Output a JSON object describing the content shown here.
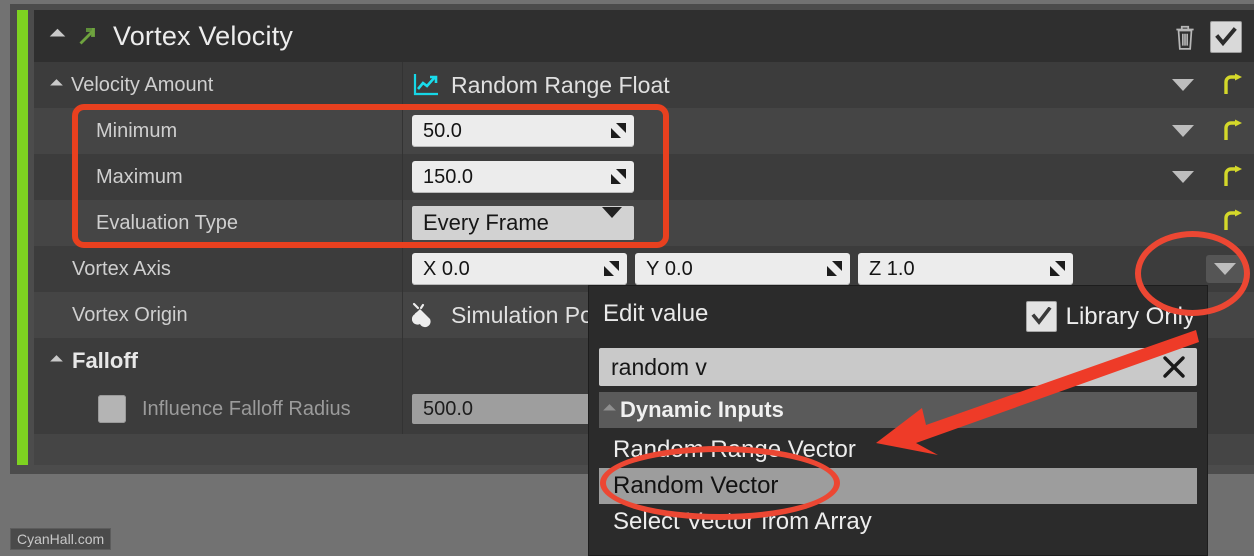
{
  "panel": {
    "category": {
      "title": "Vortex Velocity",
      "expand_icon": "collapse-triangle-icon",
      "module_icon": "green-arrow-icon",
      "delete_icon": "trash-icon",
      "enabled_checkbox": "checked"
    },
    "rows": [
      {
        "label": "Velocity Amount",
        "value_type_icon": "line-chart-icon",
        "value_text": "Random Range Float",
        "has_dropdown": true,
        "has_reset": true
      },
      {
        "label": "Minimum",
        "value_text": "50.0",
        "field_kind": "number",
        "has_dropdown": true,
        "has_reset": true
      },
      {
        "label": "Maximum",
        "value_text": "150.0",
        "field_kind": "number",
        "has_dropdown": true,
        "has_reset": true
      },
      {
        "label": "Evaluation Type",
        "value_text": "Every Frame",
        "field_kind": "combo",
        "has_dropdown": false,
        "has_reset": true
      },
      {
        "label": "Vortex Axis",
        "field_kind": "vector",
        "components": [
          {
            "axis": "X",
            "value": "0.0"
          },
          {
            "axis": "Y",
            "value": "0.0"
          },
          {
            "axis": "Z",
            "value": "1.0"
          }
        ],
        "has_dropdown": true,
        "has_reset": false
      },
      {
        "label": "Vortex Origin",
        "value_type_icon": "plug-icon",
        "value_text": "Simulation Pos",
        "field_kind": "linked"
      }
    ],
    "falloff": {
      "header": "Falloff",
      "rows": [
        {
          "label": "Influence Falloff Radius",
          "checkbox": "unchecked",
          "value_text": "500.0"
        }
      ]
    }
  },
  "popup": {
    "title": "Edit value",
    "library_only_label": "Library Only",
    "library_only_state": "checked",
    "search_value": "random v",
    "search_clear_icon": "close-icon",
    "category": "Dynamic Inputs",
    "options": [
      {
        "label": "Random Range Vector",
        "selected": false
      },
      {
        "label": "Random Vector",
        "selected": true
      },
      {
        "label": "Select Vector from Array",
        "selected": false
      }
    ]
  },
  "annotations": {
    "accent_color": "#e8401f",
    "highlight_box": "minimum-maximum-evaluation-group",
    "ellipse_dropdown": "vortex-axis-dropdown",
    "ellipse_option": "random-vector-option",
    "arrow": "points-to-random-vector-option"
  },
  "watermark": "CyanHall.com"
}
